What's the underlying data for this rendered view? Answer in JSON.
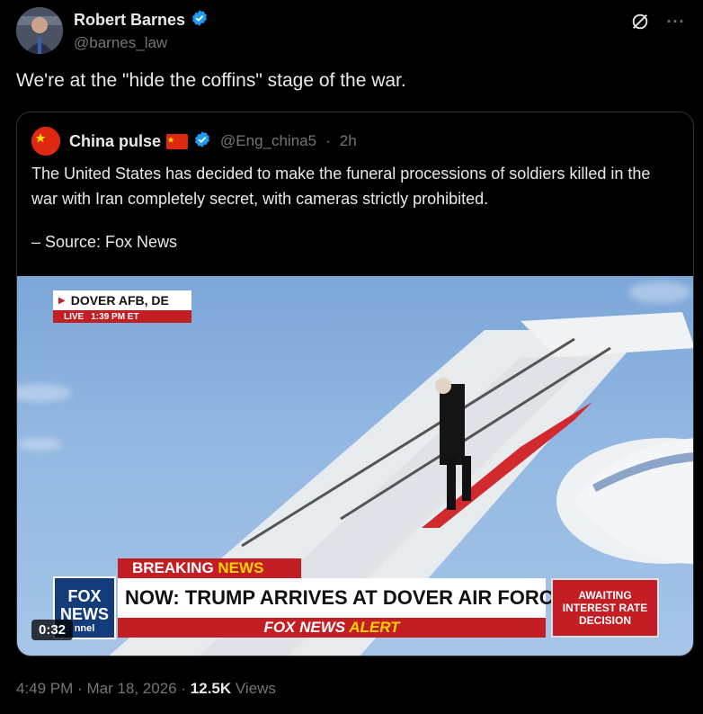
{
  "author": {
    "display_name": "Robert Barnes",
    "handle": "@barnes_law",
    "verified": true
  },
  "tweet": {
    "text": "We're at the \"hide the coffins\" stage of the war."
  },
  "quote": {
    "display_name": "China pulse",
    "handle": "@Eng_china5",
    "separator": "·",
    "age": "2h",
    "text": "The United States has decided to make the funeral processions of soldiers killed in the war with Iran completely secret, with cameras strictly prohibited.",
    "source": "– Source: Fox News",
    "video": {
      "location": "DOVER AFB, DE",
      "live_label": "LIVE",
      "live_time": "1:39 PM ET",
      "breaking": "BREAKING",
      "breaking_news": "NEWS",
      "logo_line1": "FOX",
      "logo_line2": "NEWS",
      "logo_line3": "nnel",
      "headline": "NOW: TRUMP ARRIVES AT DOVER AIR FORCE BASE",
      "alert_brand": "FOX NEWS",
      "alert_word": "ALERT",
      "side_text": "AWAITING INTEREST RATE DECISION",
      "duration": "0:32"
    }
  },
  "meta": {
    "time": "4:49 PM",
    "date": "Mar 18, 2026",
    "sep": "·",
    "views_count": "12.5K",
    "views_label": "Views"
  },
  "icons": {
    "verified": "verified-badge-icon",
    "grok": "grok-icon",
    "more": "more-icon"
  },
  "colors": {
    "background": "#000000",
    "text": "#e7e9ea",
    "muted": "#71767b",
    "verified": "#1d9bf0",
    "fox_red": "#c41e25"
  }
}
